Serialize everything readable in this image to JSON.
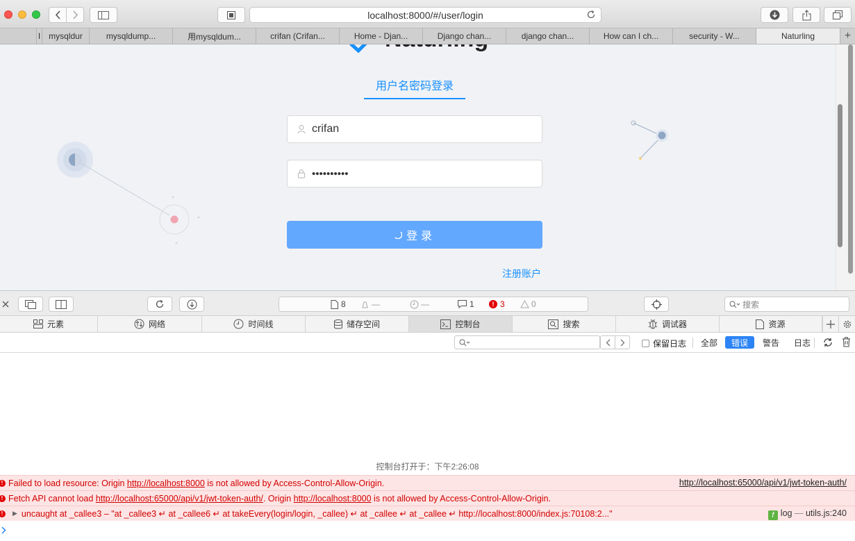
{
  "browser": {
    "url": "localhost:8000/#/user/login",
    "tabs": [
      {
        "label": "I"
      },
      {
        "label": "mysqldur"
      },
      {
        "label": "mysqldump..."
      },
      {
        "label": "用mysqldum..."
      },
      {
        "label": "crifan (Crifan..."
      },
      {
        "label": "Home - Djan..."
      },
      {
        "label": "Django chan..."
      },
      {
        "label": "django chan..."
      },
      {
        "label": "How can I ch..."
      },
      {
        "label": "security - W..."
      },
      {
        "label": "Naturling"
      }
    ],
    "new_tab": "+"
  },
  "login_page": {
    "brand": "Naturling",
    "tab_label": "用户名密码登录",
    "username_value": "crifan",
    "password_value": "••••••••••",
    "login_button": "登录",
    "register_link": "注册账户"
  },
  "devtools": {
    "status": {
      "resources": "8",
      "network_dash": "—",
      "time_dash": "—",
      "messages": "1",
      "errors": "3",
      "warnings": "0"
    },
    "search_placeholder": "搜索",
    "tabs": [
      {
        "label": "元素",
        "icon": "elements-icon"
      },
      {
        "label": "网络",
        "icon": "network-icon"
      },
      {
        "label": "时间线",
        "icon": "timeline-icon"
      },
      {
        "label": "储存空间",
        "icon": "storage-icon"
      },
      {
        "label": "控制台",
        "icon": "console-icon"
      },
      {
        "label": "搜索",
        "icon": "search-icon"
      },
      {
        "label": "调试器",
        "icon": "debugger-icon"
      },
      {
        "label": "资源",
        "icon": "resources-icon"
      }
    ],
    "filter": {
      "preserve_log": "保留日志",
      "all": "全部",
      "errors": "错误",
      "warnings": "警告",
      "logs": "日志"
    },
    "console": {
      "opened_at": "控制台打开于：下午2:26:08",
      "msg1": {
        "prefix": "Failed to load resource: Origin ",
        "origin": "http://localhost:8000",
        "suffix": " is not allowed by Access-Control-Allow-Origin.",
        "source": "http://localhost:65000/api/v1/jwt-token-auth/"
      },
      "msg2": {
        "prefix": "Fetch API cannot load ",
        "url": "http://localhost:65000/api/v1/jwt-token-auth/",
        "middle": ". Origin ",
        "origin": "http://localhost:8000",
        "suffix": " is not allowed by Access-Control-Allow-Origin."
      },
      "msg3": {
        "text": "uncaught at _callee3 – \"at _callee3 ↵ at _callee6 ↵ at takeEvery(login/login, _callee) ↵ at _callee ↵ at _callee ↵ http://localhost:8000/index.js:70108:2...\"",
        "source_fn": "log",
        "source_sep": " — ",
        "source_file": "utils.js:240"
      }
    }
  }
}
